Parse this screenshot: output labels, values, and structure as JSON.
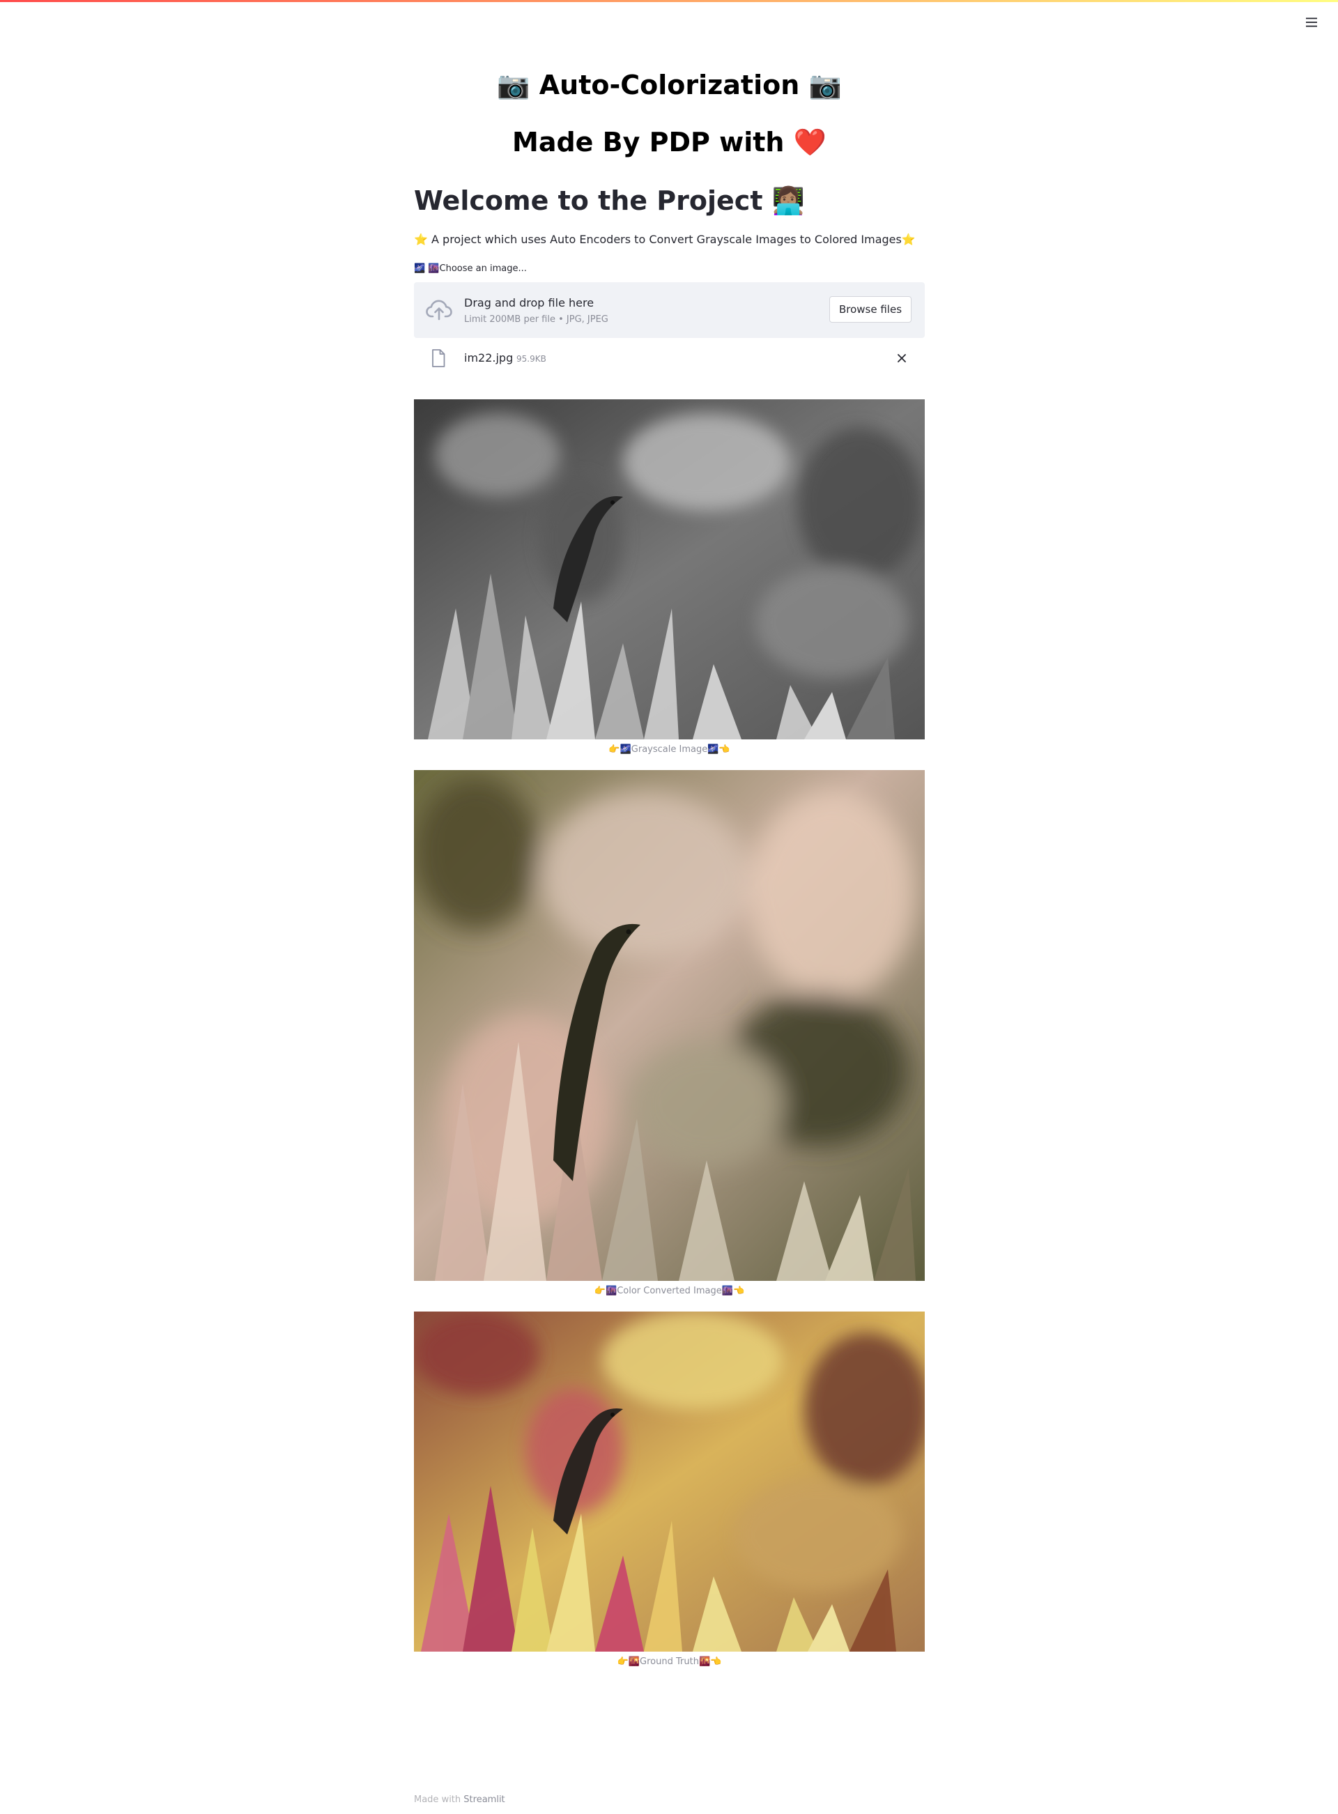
{
  "app": {
    "title": "📷 Auto-Colorization 📷",
    "subtitle": "Made By PDP with ❤️",
    "welcome_heading": "Welcome to the Project 👩🏽‍💻",
    "description": "⭐ A project which uses Auto Encoders to Convert Grayscale Images to Colored Images⭐",
    "accent_color": "#ff4b4b"
  },
  "uploader": {
    "label": "🌌 🌆Choose an image...",
    "drop_title": "Drag and drop file here",
    "limit_text": "Limit 200MB per file • JPG, JPEG",
    "browse_label": "Browse files",
    "icon": "cloud-upload-icon"
  },
  "uploaded_file": {
    "name": "im22.jpg",
    "size": "95.9KB",
    "icon": "file-icon",
    "remove_icon": "close-icon"
  },
  "images": [
    {
      "caption": "👉🌌Grayscale Image🌌👈",
      "kind": "grayscale"
    },
    {
      "caption": "👉🌆Color Converted Image🌆👈",
      "kind": "colorized"
    },
    {
      "caption": "👉🌇Ground Truth🌇👈",
      "kind": "ground-truth"
    }
  ],
  "footer": {
    "prefix": "Made with",
    "link_text": "Streamlit"
  }
}
